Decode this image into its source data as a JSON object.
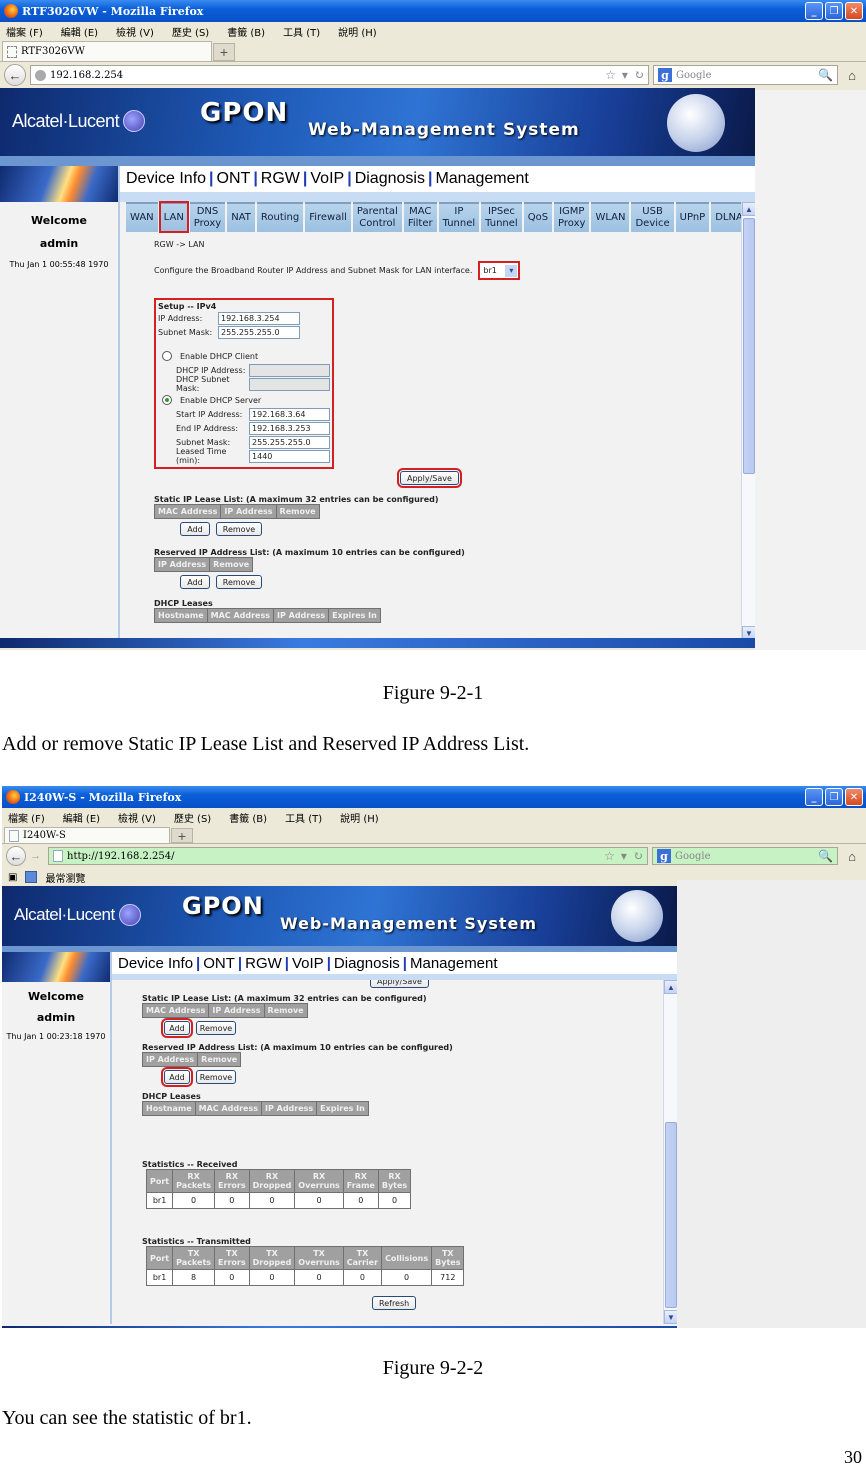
{
  "figure1": {
    "browser": {
      "window_title": "RTF3026VW - Mozilla Firefox",
      "menu": [
        "檔案 (F)",
        "編輯 (E)",
        "檢視 (V)",
        "歷史 (S)",
        "書籤 (B)",
        "工具 (T)",
        "說明 (H)"
      ],
      "tab_title": "RTF3026VW",
      "new_tab": "+",
      "url": "192.168.2.254",
      "search_placeholder": "Google"
    },
    "banner": {
      "brand": "Alcatel·Lucent",
      "product": "GPON",
      "system": "Web-Management System"
    },
    "sidebar": {
      "welcome": "Welcome",
      "user": "admin",
      "datetime": "Thu Jan 1 00:55:48 1970"
    },
    "topnav": [
      "Device Info",
      "ONT",
      "RGW",
      "VoIP",
      "Diagnosis",
      "Management"
    ],
    "subtabs": [
      {
        "label": "WAN"
      },
      {
        "label": "LAN",
        "active": true
      },
      {
        "label": "DNS\nProxy"
      },
      {
        "label": "NAT"
      },
      {
        "label": "Routing"
      },
      {
        "label": "Firewall"
      },
      {
        "label": "Parental\nControl"
      },
      {
        "label": "MAC\nFilter"
      },
      {
        "label": "IP\nTunnel"
      },
      {
        "label": "IPSec\nTunnel"
      },
      {
        "label": "QoS"
      },
      {
        "label": "IGMP\nProxy"
      },
      {
        "label": "WLAN"
      },
      {
        "label": "USB\nDevice"
      },
      {
        "label": "UPnP"
      },
      {
        "label": "DLNA"
      }
    ],
    "lan": {
      "breadcrumb": "RGW -> LAN",
      "configure_text": "Configure the Broadband Router IP Address and Subnet Mask for LAN interface.",
      "interface_select": "br1",
      "setup_title": "Setup -- IPv4",
      "ip_label": "IP Address:",
      "ip_value": "192.168.3.254",
      "mask_label": "Subnet Mask:",
      "mask_value": "255.255.255.0",
      "dhcp_client_label": "Enable DHCP Client",
      "dhcp_client_checked": false,
      "dhcp_ip_label": "DHCP IP Address:",
      "dhcp_ip_value": "",
      "dhcp_mask_label": "DHCP Subnet Mask:",
      "dhcp_mask_value": "",
      "dhcp_server_label": "Enable DHCP Server",
      "dhcp_server_checked": true,
      "start_ip_label": "Start IP Address:",
      "start_ip_value": "192.168.3.64",
      "end_ip_label": "End IP Address:",
      "end_ip_value": "192.168.3.253",
      "server_mask_label": "Subnet Mask:",
      "server_mask_value": "255.255.255.0",
      "lease_label": "Leased Time (min):",
      "lease_value": "1440",
      "apply_label": "Apply/Save",
      "static_title": "Static IP Lease List: (A maximum 32 entries can be configured)",
      "static_headers": [
        "MAC Address",
        "IP Address",
        "Remove"
      ],
      "reserved_title": "Reserved IP Address List: (A maximum 10 entries can be configured)",
      "reserved_headers": [
        "IP Address",
        "Remove"
      ],
      "add_label": "Add",
      "remove_label": "Remove",
      "leases_title": "DHCP Leases",
      "leases_headers": [
        "Hostname",
        "MAC Address",
        "IP Address",
        "Expires In"
      ]
    }
  },
  "caption1": "Figure 9-2-1",
  "text1": "Add or remove Static IP Lease List and Reserved IP Address List.",
  "figure2": {
    "browser": {
      "window_title": "I240W-S - Mozilla Firefox",
      "menu": [
        "檔案 (F)",
        "編輯 (E)",
        "檢視 (V)",
        "歷史 (S)",
        "書籤 (B)",
        "工具 (T)",
        "說明 (H)"
      ],
      "tab_title": "I240W-S",
      "new_tab": "+",
      "url": "http://192.168.2.254/",
      "search_placeholder": "Google",
      "bookmark": "最常瀏覽"
    },
    "banner": {
      "brand": "Alcatel·Lucent",
      "product": "GPON",
      "system": "Web-Management System"
    },
    "sidebar": {
      "welcome": "Welcome",
      "user": "admin",
      "datetime": "Thu Jan 1 00:23:18 1970"
    },
    "topnav": [
      "Device Info",
      "ONT",
      "RGW",
      "VoIP",
      "Diagnosis",
      "Management"
    ],
    "lan": {
      "apply_label": "Apply/Save",
      "static_title": "Static IP Lease List: (A maximum 32 entries can be configured)",
      "static_headers": [
        "MAC Address",
        "IP Address",
        "Remove"
      ],
      "reserved_title": "Reserved IP Address List: (A maximum 10 entries can be configured)",
      "reserved_headers": [
        "IP Address",
        "Remove"
      ],
      "add_label": "Add",
      "remove_label": "Remove",
      "leases_title": "DHCP Leases",
      "leases_headers": [
        "Hostname",
        "MAC Address",
        "IP Address",
        "Expires In"
      ],
      "rx_title": "Statistics -- Received",
      "rx_headers": [
        "Port",
        "RX\nPackets",
        "RX\nErrors",
        "RX\nDropped",
        "RX\nOverruns",
        "RX\nFrame",
        "RX\nBytes"
      ],
      "rx_rows": [
        [
          "br1",
          "0",
          "0",
          "0",
          "0",
          "0",
          "0"
        ]
      ],
      "tx_title": "Statistics -- Transmitted",
      "tx_headers": [
        "Port",
        "TX\nPackets",
        "TX\nErrors",
        "TX\nDropped",
        "TX\nOverruns",
        "TX\nCarrier",
        "Collisions",
        "TX\nBytes"
      ],
      "tx_rows": [
        [
          "br1",
          "8",
          "0",
          "0",
          "0",
          "0",
          "0",
          "712"
        ]
      ],
      "refresh_label": "Refresh"
    }
  },
  "caption2": "Figure 9-2-2",
  "text2": "You can see the statistic of br1.",
  "page_number": "30"
}
